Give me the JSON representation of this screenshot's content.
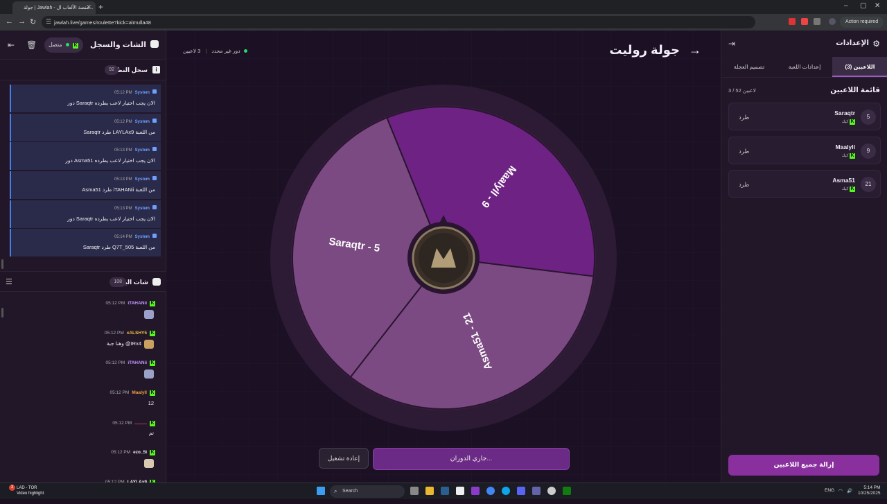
{
  "browser": {
    "tab_title": "جولة | Jawlah - منصة الألعاب ال...",
    "url": "jawlah.live/games/roulette?kick=almulla48",
    "action_required": "Action required"
  },
  "chat_panel": {
    "title": "الشات والسجل",
    "online_label": "متصل",
    "system_log": {
      "title": "سجل النظام",
      "count": "92",
      "items": [
        {
          "sender": "System",
          "time": "05:12 PM",
          "message": "دور Saraqtr الان يجب اختيار لاعب يطرده"
        },
        {
          "sender": "System",
          "time": "05:12 PM",
          "message": "Saraqtr طرد LAYLAx9 من اللعبة"
        },
        {
          "sender": "System",
          "time": "05:13 PM",
          "message": "دور Asma51 الان يجب اختيار لاعب يطرده"
        },
        {
          "sender": "System",
          "time": "05:13 PM",
          "message": "Asma51 طرد iTAHANii من اللعبة"
        },
        {
          "sender": "System",
          "time": "05:13 PM",
          "message": "دور Saraqtr الان يجب اختيار لاعب يطرده"
        },
        {
          "sender": "System",
          "time": "05:14 PM",
          "message": "Saraqtr طرد Q7T_505 من اللعبة"
        }
      ]
    },
    "live_chat": {
      "title": "شات البث",
      "count": "108",
      "items": [
        {
          "user": "iTAHANii",
          "time": "05:12 PM",
          "text": "",
          "color": "#c59bff",
          "emote": "#9aa0c8"
        },
        {
          "user": "xALSHY5",
          "time": "05:12 PM",
          "text": "وهنا جبة @IRx4",
          "color": "#f0c040",
          "emote": "#c8a060"
        },
        {
          "user": "iTAHANii",
          "time": "05:12 PM",
          "text": "",
          "color": "#c59bff",
          "emote": "#9aa0c8"
        },
        {
          "user": "Maalyll",
          "time": "05:12 PM",
          "text": "12",
          "color": "#f0a040",
          "emote": ""
        },
        {
          "user": "ــــــــ",
          "time": "05:12 PM",
          "text": "تم",
          "color": "#e04060",
          "emote": ""
        },
        {
          "user": "ezo_5i",
          "time": "05:12 PM",
          "text": "",
          "color": "#f0f0f0",
          "emote": "#d8c8b0"
        },
        {
          "user": "LAYLAx9",
          "time": "05:12 PM",
          "text": "",
          "color": "#f0f0f0",
          "emote": ""
        }
      ]
    }
  },
  "game": {
    "title": "جولة روليت",
    "players_count": "3 لاعبين",
    "turn_status": "دور غير محدد",
    "spin_label": "جاري الدوران...",
    "replay_label": "إعادة تشغيل"
  },
  "settings": {
    "title": "الإعدادات",
    "tabs": [
      "اللاعبين (3)",
      "إعدادات اللعبة",
      "تصميم العجلة"
    ],
    "list_title": "قائمة اللاعبين",
    "list_count": "3 / 52 لاعبين",
    "kick_label": "طرد",
    "platform_label": "كيك",
    "players": [
      {
        "num": "5",
        "name": "Saraqtr"
      },
      {
        "num": "9",
        "name": "Maalyll"
      },
      {
        "num": "21",
        "name": "Asma51"
      }
    ],
    "remove_all_label": "إزالة جميع اللاعبين"
  },
  "wheel": {
    "segments": [
      {
        "label": "Maalyll - 9",
        "color": "#6e2283"
      },
      {
        "label": "Asma51 - 21",
        "color": "#7b4a82"
      },
      {
        "label": "Saraqtr - 5",
        "color": "#7b4a82"
      }
    ]
  },
  "taskbar": {
    "weather_line1": "LAD - TOR",
    "weather_line2": "Video highlight",
    "badge": "3",
    "search_label": "Search",
    "lang": "ENG",
    "time": "5:14 PM",
    "date": "10/25/2025"
  }
}
